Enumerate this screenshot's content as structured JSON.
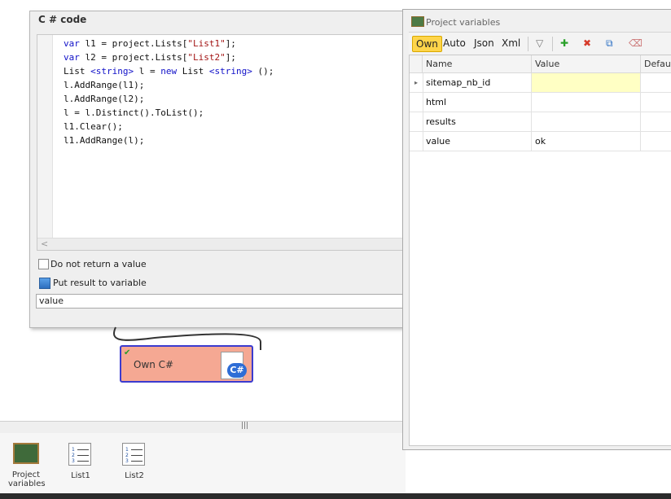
{
  "code_window": {
    "title": "C # code",
    "lines": [
      "var l1 = project.Lists[\"List1\"];",
      "var l2 = project.Lists[\"List2\"];",
      "List <string> l = new List <string> ();",
      "l.AddRange(l1);",
      "l.AddRange(l2);",
      "l = l.Distinct().ToList();",
      "l1.Clear();",
      "l1.AddRange(l);"
    ],
    "scroll_left_glyph": "<",
    "do_not_return_label": "Do not return a value",
    "do_not_return_checked": false,
    "put_result_label": "Put result to variable",
    "result_variable": "value"
  },
  "canvas": {
    "node_label": "Own C#",
    "node_badge": "C#",
    "node_status_glyph": "✔"
  },
  "bottom_panel": {
    "grip": "|||",
    "items": [
      {
        "label_line1": "Project",
        "label_line2": "variables",
        "icon": "chalkboard-icon"
      },
      {
        "label_line1": "List1",
        "label_line2": "",
        "icon": "numbered-list-icon"
      },
      {
        "label_line1": "List2",
        "label_line2": "",
        "icon": "numbered-list-icon"
      }
    ]
  },
  "vars_window": {
    "title": "Project variables",
    "tabs": [
      "Own",
      "Auto",
      "Json",
      "Xml"
    ],
    "active_tab": "Own",
    "tool_icons": {
      "filter": "▽",
      "add": "✚",
      "delete": "✖",
      "rename": "⧉",
      "clear": "⌫"
    },
    "columns": [
      "Name",
      "Value",
      "Default"
    ],
    "rows": [
      {
        "name": "sitemap_nb_id",
        "value": "",
        "selected": true
      },
      {
        "name": "html",
        "value": ""
      },
      {
        "name": "results",
        "value": ""
      },
      {
        "name": "value",
        "value": "ok"
      }
    ],
    "row_pointer_glyph": "▸"
  }
}
